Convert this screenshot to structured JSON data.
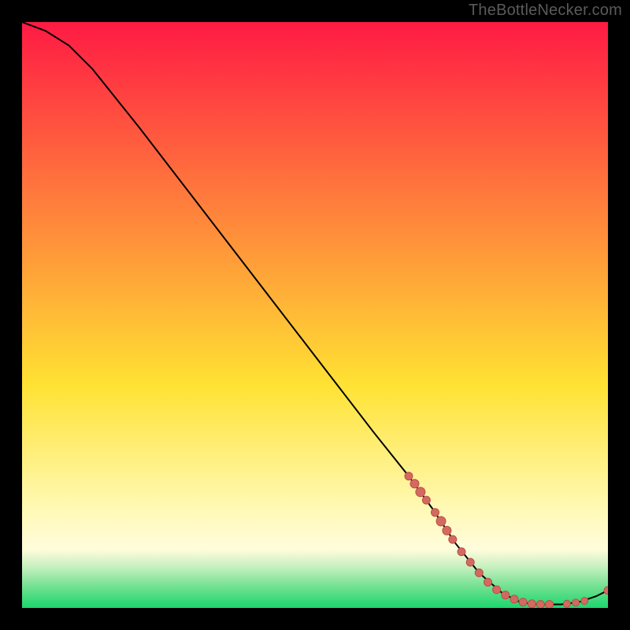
{
  "attribution": "TheBottleNecker.com",
  "colors": {
    "top": "#ff1a44",
    "yellow_mid": "#ffe233",
    "pale_yellow": "#fff9b5",
    "cream": "#fffcdc",
    "green_band_top": "#c6f0c0",
    "green_band_mid": "#6fe08f",
    "green_band_bottom": "#1bd66e",
    "curve": "#000000",
    "marker_fill": "#d46a5f",
    "marker_stroke": "#b94f47"
  },
  "chart_data": {
    "type": "line",
    "title": "",
    "xlabel": "",
    "ylabel": "",
    "xlim": [
      0,
      100
    ],
    "ylim": [
      0,
      100
    ],
    "curve": [
      {
        "x": 0,
        "y": 100
      },
      {
        "x": 4,
        "y": 98.5
      },
      {
        "x": 8,
        "y": 96
      },
      {
        "x": 12,
        "y": 92
      },
      {
        "x": 20,
        "y": 82
      },
      {
        "x": 30,
        "y": 69
      },
      {
        "x": 40,
        "y": 56
      },
      {
        "x": 50,
        "y": 43
      },
      {
        "x": 60,
        "y": 30
      },
      {
        "x": 66,
        "y": 22.5
      },
      {
        "x": 70,
        "y": 17
      },
      {
        "x": 74,
        "y": 11
      },
      {
        "x": 78,
        "y": 6
      },
      {
        "x": 82,
        "y": 2.5
      },
      {
        "x": 85,
        "y": 1
      },
      {
        "x": 88,
        "y": 0.6
      },
      {
        "x": 92,
        "y": 0.6
      },
      {
        "x": 95,
        "y": 1
      },
      {
        "x": 98,
        "y": 2
      },
      {
        "x": 100,
        "y": 3
      }
    ],
    "markers": [
      {
        "x": 66,
        "y": 22.5,
        "r": 5
      },
      {
        "x": 67,
        "y": 21.2,
        "r": 5.5
      },
      {
        "x": 68,
        "y": 19.8,
        "r": 6
      },
      {
        "x": 69,
        "y": 18.4,
        "r": 5
      },
      {
        "x": 70.5,
        "y": 16.3,
        "r": 5
      },
      {
        "x": 71.5,
        "y": 14.8,
        "r": 6
      },
      {
        "x": 72.5,
        "y": 13.2,
        "r": 5.5
      },
      {
        "x": 73.5,
        "y": 11.7,
        "r": 5
      },
      {
        "x": 75,
        "y": 9.6,
        "r": 5
      },
      {
        "x": 76.5,
        "y": 7.8,
        "r": 5
      },
      {
        "x": 78,
        "y": 6,
        "r": 5
      },
      {
        "x": 79.5,
        "y": 4.4,
        "r": 5
      },
      {
        "x": 81,
        "y": 3.1,
        "r": 5
      },
      {
        "x": 82.5,
        "y": 2.2,
        "r": 5
      },
      {
        "x": 84,
        "y": 1.5,
        "r": 5
      },
      {
        "x": 85.5,
        "y": 1,
        "r": 5
      },
      {
        "x": 87,
        "y": 0.7,
        "r": 5
      },
      {
        "x": 88.5,
        "y": 0.6,
        "r": 5
      },
      {
        "x": 90,
        "y": 0.6,
        "r": 5
      },
      {
        "x": 93,
        "y": 0.7,
        "r": 4.5
      },
      {
        "x": 94.5,
        "y": 0.9,
        "r": 4.5
      },
      {
        "x": 96,
        "y": 1.2,
        "r": 4.5
      },
      {
        "x": 100,
        "y": 3,
        "r": 5
      }
    ]
  }
}
